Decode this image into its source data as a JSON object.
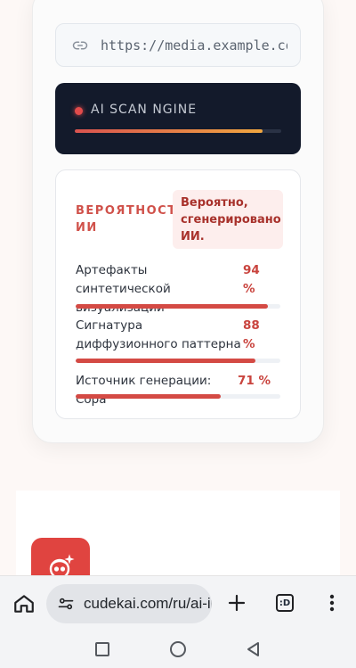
{
  "url_field": {
    "value": "https://media.example.com/image.jpg",
    "icon": "link-icon"
  },
  "scanner": {
    "label": "AI SCAN NGINE",
    "progress": 0.91,
    "status_color": "#e24b4b"
  },
  "result": {
    "title": "ВЕРОЯТНОСТЬ ИИ",
    "verdict": "Вероятно, сгенерировано ИИ.",
    "metrics": [
      {
        "label": "Артефакты синтетической визуализации",
        "value": "94 %",
        "fraction": 0.94
      },
      {
        "label": "Сигнатура диффузионного паттерна",
        "value": "88 %",
        "fraction": 0.88
      },
      {
        "label": "Источник генерации: Сора",
        "value": "71 %",
        "fraction": 0.71
      }
    ]
  },
  "app_icon": {
    "name": "robot-face-icon",
    "color": "#e04440"
  },
  "browser": {
    "address": "cudekai.com/ru/ai-image-detector",
    "tab_label": ":D",
    "icons": [
      "home-icon",
      "site-settings-icon",
      "new-tab-icon",
      "tabs-icon",
      "menu-icon"
    ]
  },
  "navigation": {
    "icons": [
      "recents-icon",
      "home-circle-icon",
      "back-icon"
    ]
  }
}
